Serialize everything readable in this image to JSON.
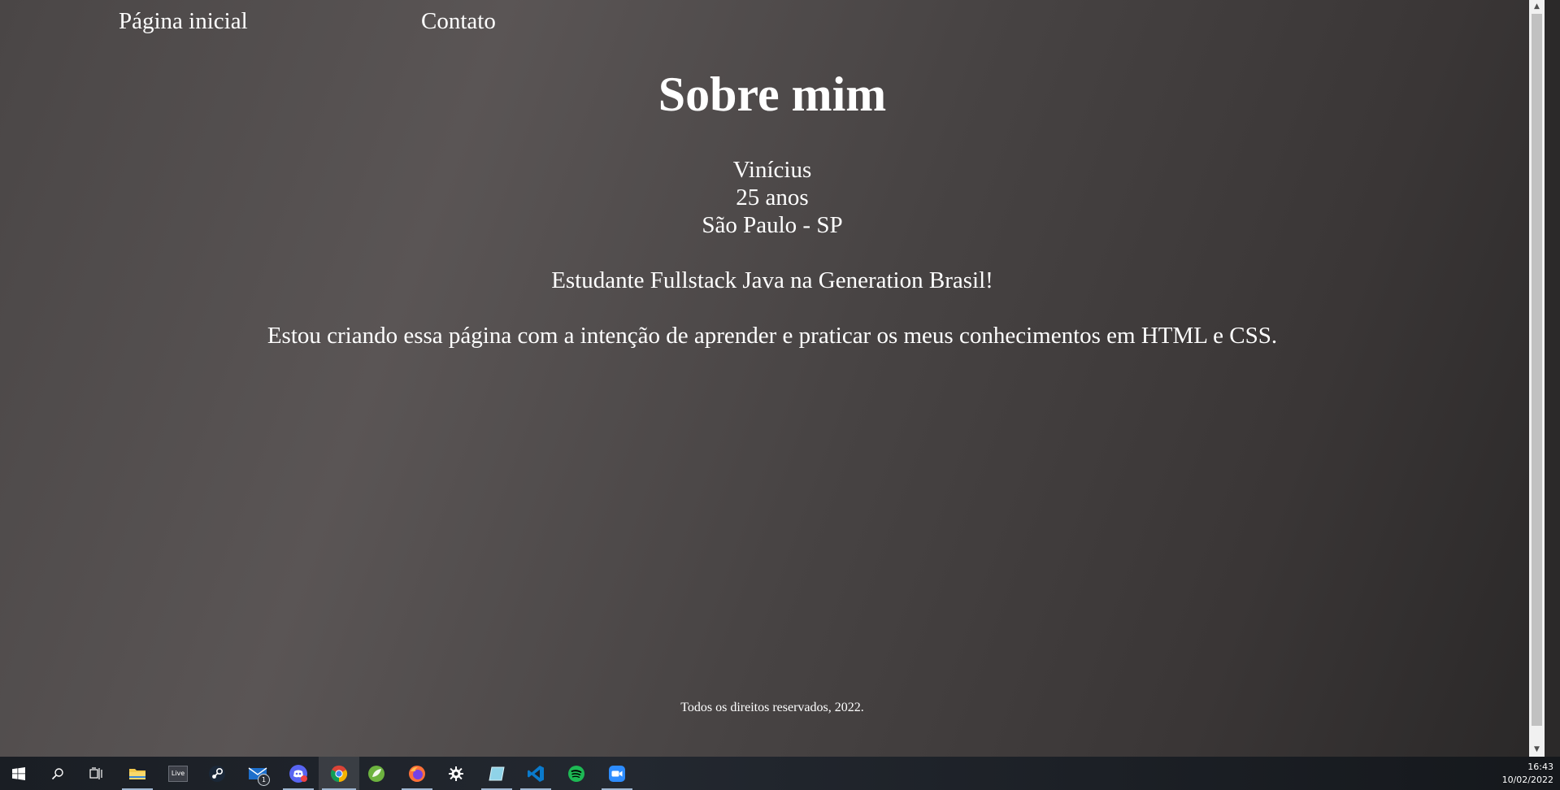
{
  "nav": {
    "home_label": "Página inicial",
    "contact_label": "Contato"
  },
  "main": {
    "title": "Sobre mim",
    "name": "Vinícius",
    "age": "25 anos",
    "location": "São Paulo - SP",
    "study": "Estudante Fullstack Java na Generation Brasil!",
    "description": "Estou criando essa página com a intenção de aprender e praticar os meus conhecimentos em HTML e CSS."
  },
  "footer": {
    "text": "Todos os direitos reservados, 2022."
  },
  "taskbar": {
    "items": [
      {
        "name": "start-icon"
      },
      {
        "name": "search-icon"
      },
      {
        "name": "task-view-icon"
      },
      {
        "name": "file-explorer-icon"
      },
      {
        "name": "live-icon",
        "label": "Live"
      },
      {
        "name": "steam-icon"
      },
      {
        "name": "mail-icon",
        "badge": "1"
      },
      {
        "name": "discord-icon"
      },
      {
        "name": "chrome-icon"
      },
      {
        "name": "spring-icon"
      },
      {
        "name": "firefox-icon"
      },
      {
        "name": "settings-icon"
      },
      {
        "name": "notepad-icon"
      },
      {
        "name": "vscode-icon"
      },
      {
        "name": "spotify-icon"
      },
      {
        "name": "zoom-icon"
      }
    ],
    "clock_time": "16:43",
    "clock_date": "10/02/2022"
  },
  "colors": {
    "background_start": "#5a5555",
    "background_end": "#2a2828",
    "text": "#ffffff",
    "taskbar": "#1c2026"
  }
}
